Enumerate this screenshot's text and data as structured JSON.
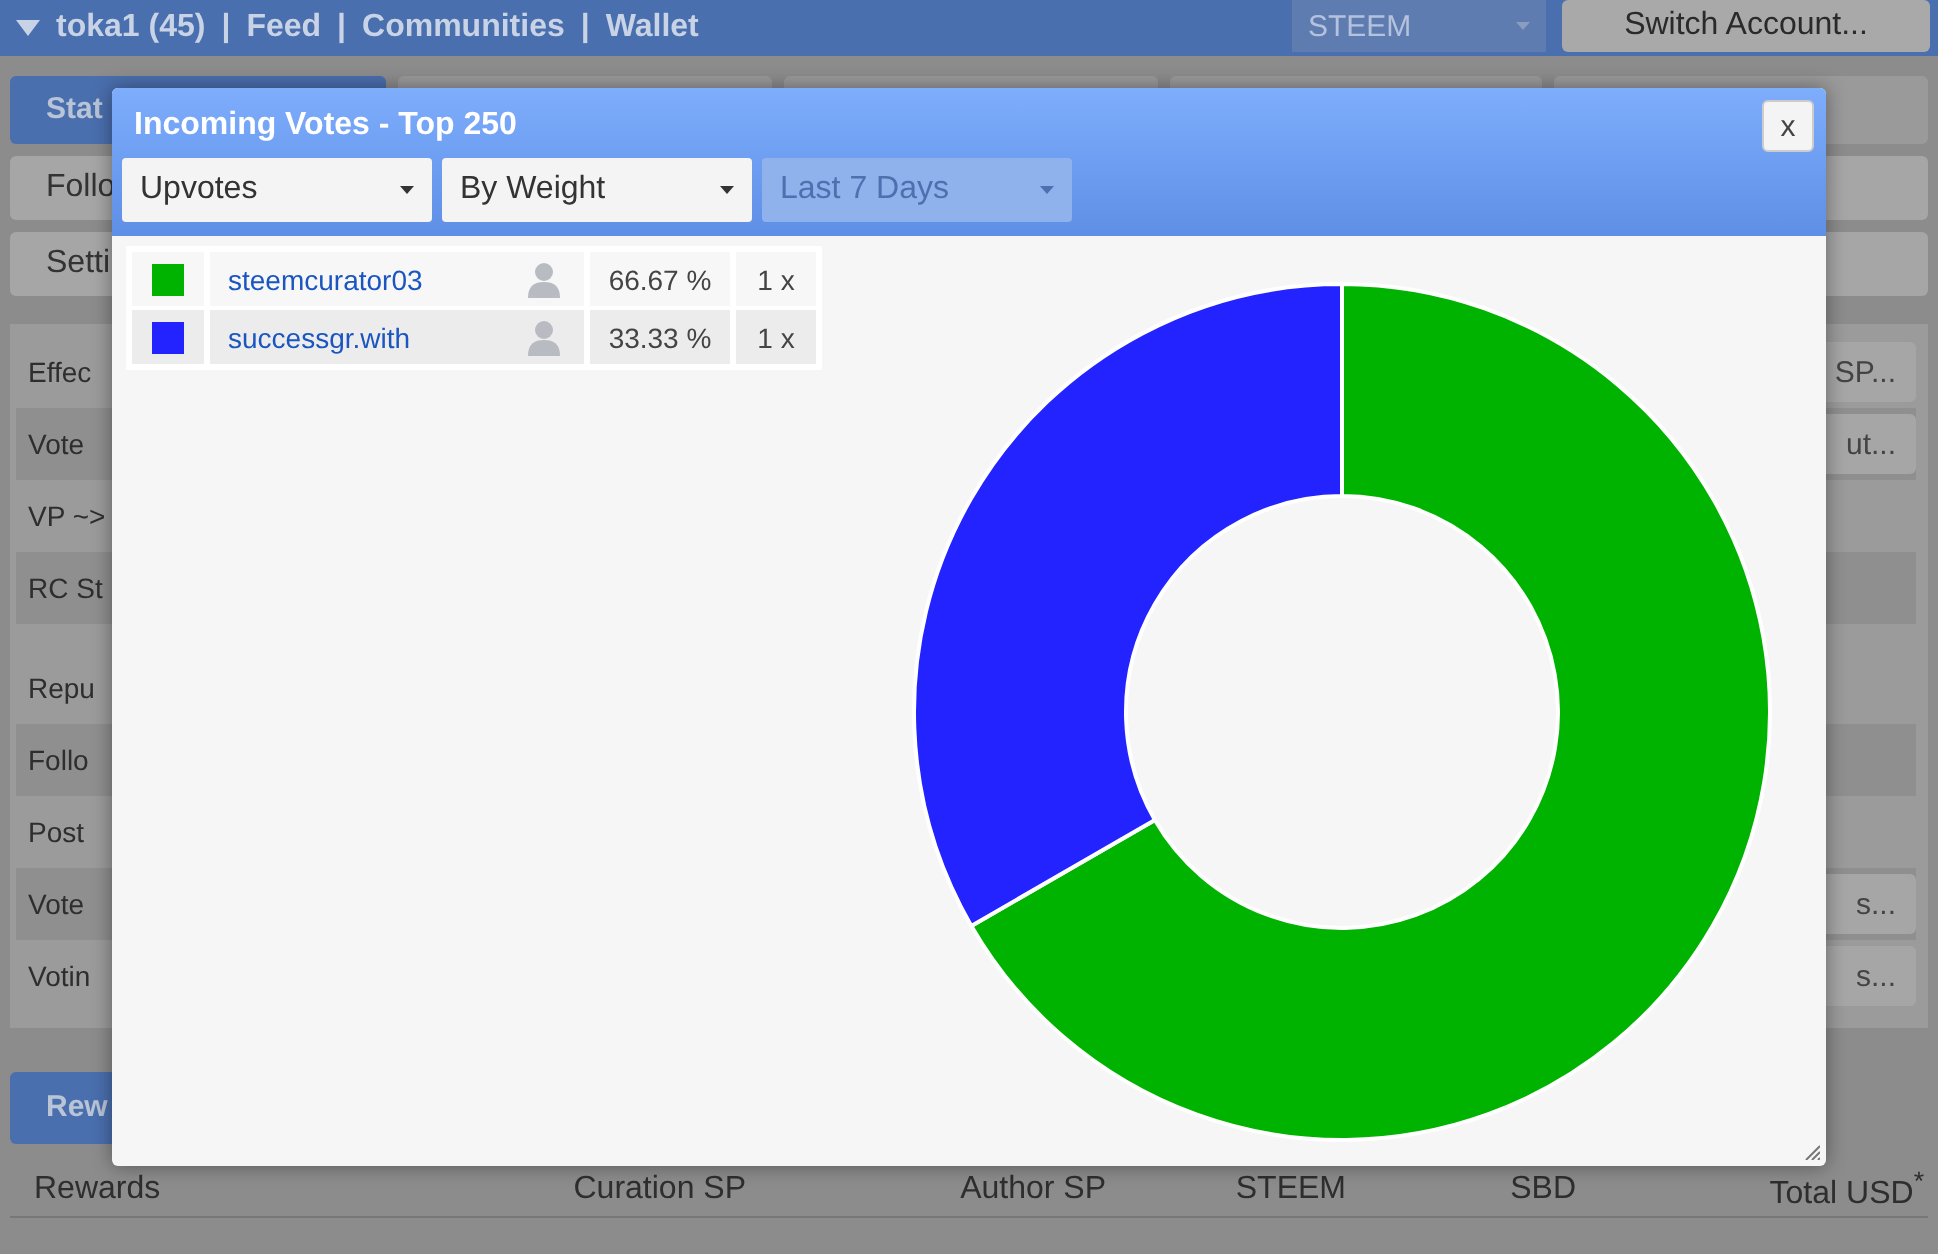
{
  "nav": {
    "items": [
      {
        "kind": "user",
        "label": "toka1 (45)"
      },
      {
        "kind": "sep",
        "label": "|"
      },
      {
        "kind": "link",
        "label": "Feed"
      },
      {
        "kind": "sep",
        "label": "|"
      },
      {
        "kind": "link",
        "label": "Communities"
      },
      {
        "kind": "sep",
        "label": "|"
      },
      {
        "kind": "link",
        "label": "Wallet"
      }
    ],
    "currency_select": {
      "value": "STEEM"
    },
    "switch_button": "Switch Account..."
  },
  "tabs": [
    {
      "label": "Stat",
      "selected": true
    }
  ],
  "menu_buttons": [
    "Follo",
    "Setti"
  ],
  "stats_rows": [
    {
      "label": "Effec",
      "button": "SP..."
    },
    {
      "label": "Vote",
      "button": "ut..."
    },
    {
      "label": "VP ~>"
    },
    {
      "label": "RC St"
    },
    {
      "label": "Repu"
    },
    {
      "label": "Follo"
    },
    {
      "label": "Post"
    },
    {
      "label": "Vote",
      "button": "s..."
    },
    {
      "label": "Votin",
      "button": "s..."
    }
  ],
  "rewards_tab": {
    "label": "Rew",
    "selected": true
  },
  "rewards_table": {
    "columns": [
      "Rewards",
      "Curation SP",
      "Author SP",
      "STEEM",
      "SBD",
      "Total USD$^{*}$"
    ]
  },
  "dialog": {
    "title": "Incoming Votes - Top 250",
    "close": "x",
    "filters": [
      {
        "value": "Upvotes",
        "disabled": false
      },
      {
        "value": "By Weight",
        "disabled": false
      },
      {
        "value": "Last 7 Days",
        "disabled": true
      }
    ],
    "voters": [
      {
        "color": "#00b300",
        "share": "66.67 %",
        "count": "1 x"
      },
      {
        "color": "#2323ff",
        "share": "33.33 %",
        "count": "1 x"
      }
    ],
    "chart_data": {
      "type": "donut",
      "categories": [
        "steemcurator03",
        "successgr.with"
      ],
      "values": [
        66.67,
        33.33
      ]
    }
  }
}
